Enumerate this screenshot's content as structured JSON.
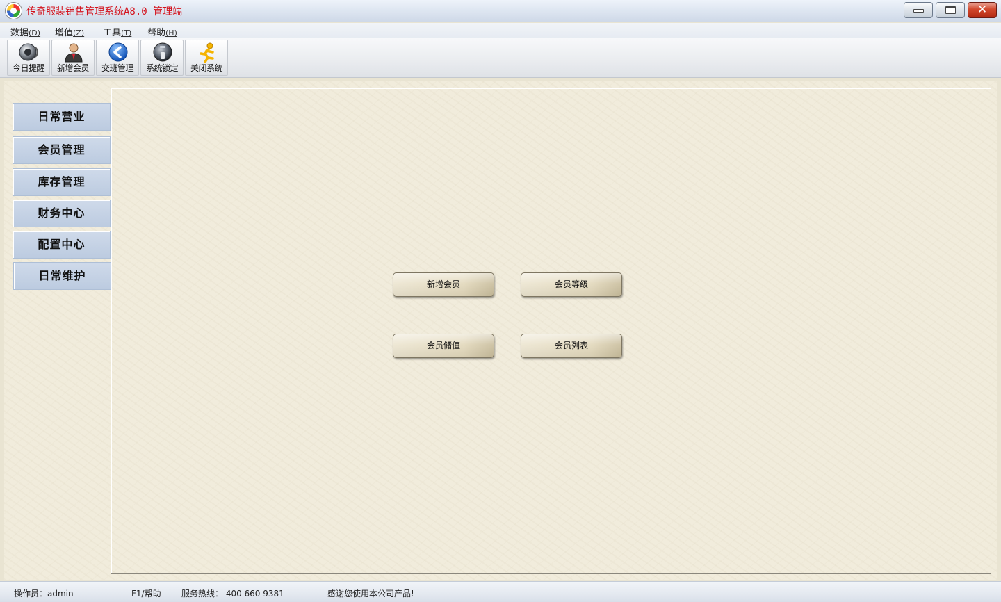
{
  "window": {
    "title": "传奇服装销售管理系统A8.0 管理端"
  },
  "menu": [
    {
      "label": "数据",
      "accel": "(D)"
    },
    {
      "label": "增值",
      "accel": "(Z)"
    },
    {
      "label": "工具",
      "accel": "(T)"
    },
    {
      "label": "帮助",
      "accel": "(H)"
    }
  ],
  "toolbar": [
    {
      "label": "今日提醒",
      "icon": "speaker-icon"
    },
    {
      "label": "新增会员",
      "icon": "user-icon"
    },
    {
      "label": "交班管理",
      "icon": "back-arrow-icon"
    },
    {
      "label": "系统锁定",
      "icon": "lock-icon"
    },
    {
      "label": "关闭系统",
      "icon": "runner-icon"
    }
  ],
  "sidebar": [
    {
      "label": "日常营业"
    },
    {
      "label": "会员管理"
    },
    {
      "label": "库存管理"
    },
    {
      "label": "财务中心"
    },
    {
      "label": "配置中心"
    },
    {
      "label": "日常维护"
    }
  ],
  "actions": [
    {
      "label": "新增会员"
    },
    {
      "label": "会员等级"
    },
    {
      "label": "会员储值"
    },
    {
      "label": "会员列表"
    }
  ],
  "status": {
    "operator": "操作员：admin",
    "help": "F1/帮助",
    "hotline": "服务热线： 400 660 9381",
    "thanks": "感谢您使用本公司产品!"
  },
  "colors": {
    "title_text": "#d4111b",
    "sidebar_button": "#c4d1e4",
    "background": "#f1ecdc"
  }
}
